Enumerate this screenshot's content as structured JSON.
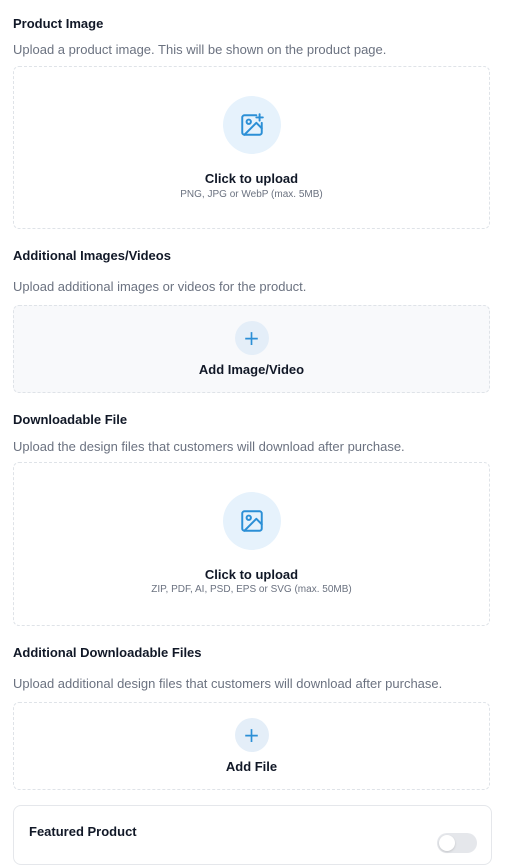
{
  "product_image": {
    "title": "Product Image",
    "description": "Upload a product image. This will be shown on the product page.",
    "upload_label": "Click to upload",
    "upload_hint": "PNG, JPG or WebP (max. 5MB)",
    "icon": "image-plus-icon"
  },
  "additional_media": {
    "title": "Additional Images/Videos",
    "description": "Upload additional images or videos for the product.",
    "button_label": "Add Image/Video",
    "icon": "plus-icon"
  },
  "downloadable_file": {
    "title": "Downloadable File",
    "description": "Upload the design files that customers will download after purchase.",
    "upload_label": "Click to upload",
    "upload_hint": "ZIP, PDF, AI, PSD, EPS or SVG (max. 50MB)",
    "icon": "image-icon"
  },
  "additional_files": {
    "title": "Additional Downloadable Files",
    "description": "Upload additional design files that customers will download after purchase.",
    "button_label": "Add File",
    "icon": "plus-icon"
  },
  "featured": {
    "title": "Featured Product",
    "enabled": false
  },
  "colors": {
    "accent": "#2b8fd6",
    "icon_bg": "#e6f2fc"
  }
}
